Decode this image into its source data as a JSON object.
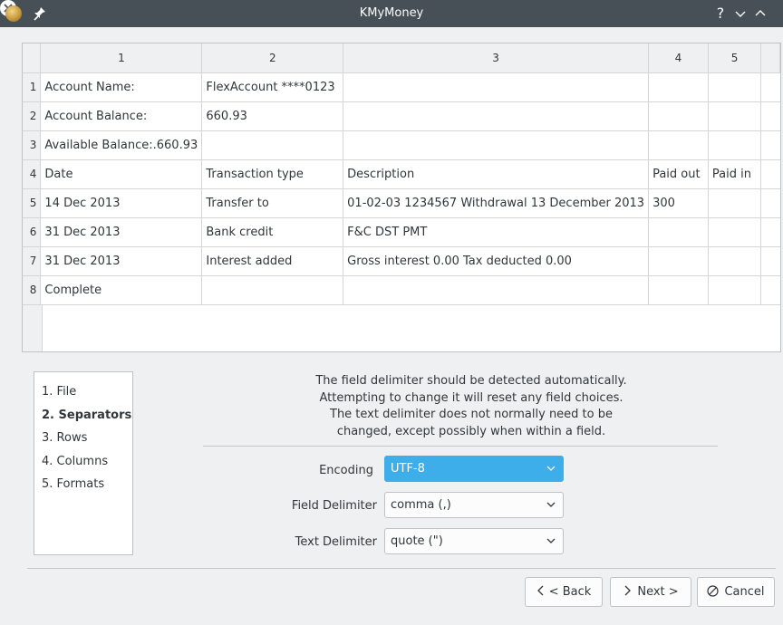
{
  "window": {
    "title": "KMyMoney",
    "help_glyph": "?"
  },
  "table": {
    "columns": [
      "1",
      "2",
      "3",
      "4",
      "5"
    ],
    "rows": [
      {
        "num": "1",
        "cells": [
          "Account Name:",
          "FlexAccount ****0123",
          "",
          "",
          ""
        ]
      },
      {
        "num": "2",
        "cells": [
          "Account Balance:",
          "660.93",
          "",
          "",
          ""
        ]
      },
      {
        "num": "3",
        "cells": [
          "Available Balance:.660.93",
          "",
          "",
          "",
          ""
        ]
      },
      {
        "num": "4",
        "cells": [
          "Date",
          "Transaction type",
          "Description",
          "Paid out",
          "Paid in"
        ]
      },
      {
        "num": "5",
        "cells": [
          "14 Dec 2013",
          "Transfer to",
          "01-02-03 1234567 Withdrawal 13 December 2013",
          "300",
          ""
        ]
      },
      {
        "num": "6",
        "cells": [
          "31 Dec 2013",
          "Bank credit",
          "F&C DST PMT",
          "",
          ""
        ]
      },
      {
        "num": "7",
        "cells": [
          "31 Dec 2013",
          "Interest added",
          "Gross interest 0.00 Tax deducted 0.00",
          "",
          ""
        ]
      },
      {
        "num": "8",
        "cells": [
          "Complete",
          "",
          "",
          "",
          ""
        ]
      }
    ]
  },
  "steps": [
    "1. File",
    "2. Separators",
    "3. Rows",
    "4. Columns",
    "5. Formats"
  ],
  "active_step": "2. Separators",
  "description": [
    "The field delimiter should be detected automatically.",
    "Attempting to change it will reset any field choices.",
    "The text delimiter does not normally need to be",
    "changed, except possibly when within a field."
  ],
  "form": {
    "encoding_label": "Encoding",
    "encoding_value": "UTF-8",
    "field_delimiter_label": "Field Delimiter",
    "field_delimiter_value": "comma (,)",
    "text_delimiter_label": "Text Delimiter",
    "text_delimiter_value": "quote (\")"
  },
  "buttons": {
    "back": "< Back",
    "next": "Next >",
    "cancel": "Cancel"
  },
  "colors": {
    "titlebar": "#475057",
    "accent": "#3daee9",
    "background": "#eff0f1"
  }
}
